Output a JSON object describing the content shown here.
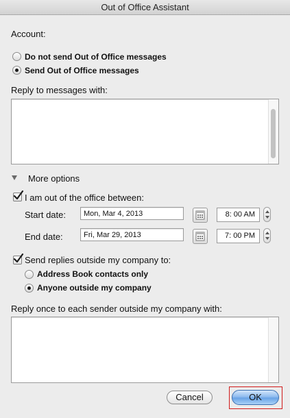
{
  "window": {
    "title": "Out of Office Assistant"
  },
  "account": {
    "label": "Account:",
    "options": [
      {
        "label": "Do not send Out of Office messages",
        "selected": false
      },
      {
        "label": "Send Out of Office messages",
        "selected": true
      }
    ]
  },
  "reply": {
    "label": "Reply to messages with:",
    "value": ""
  },
  "more_options": {
    "label": "More options",
    "expanded": true
  },
  "schedule": {
    "checkbox_label": "I am out of the office between:",
    "checked": true,
    "start_label": "Start date:",
    "start_date": "Mon, Mar 4, 2013",
    "start_time": "8: 00 AM",
    "end_label": "End date:",
    "end_date": "Fri, Mar 29, 2013",
    "end_time": "7: 00 PM"
  },
  "outside": {
    "checkbox_label": "Send replies outside my company to:",
    "checked": true,
    "options": [
      {
        "label": "Address Book contacts only",
        "selected": false
      },
      {
        "label": "Anyone outside my company",
        "selected": true
      }
    ],
    "reply_label": "Reply once to each sender outside my company with:",
    "reply_value": ""
  },
  "buttons": {
    "cancel": "Cancel",
    "ok": "OK"
  },
  "icons": {
    "calendar": "calendar-icon",
    "checkmark": "checkmark-icon",
    "disclosure": "disclosure-triangle-icon"
  },
  "colors": {
    "accent": "#6aa3e6",
    "highlight": "#d11a1a",
    "background": "#ececec"
  }
}
